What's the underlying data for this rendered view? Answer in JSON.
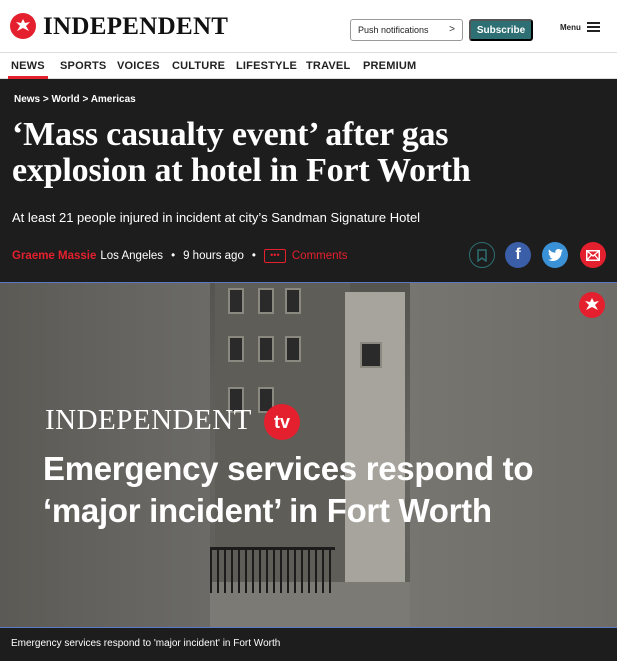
{
  "header": {
    "brand": "INDEPENDENT",
    "push_label": "Push notifications",
    "push_chevron": ">",
    "subscribe_label": "Subscribe",
    "menu_label": "Menu"
  },
  "nav": {
    "items": [
      "NEWS",
      "SPORTS",
      "VOICES",
      "CULTURE",
      "LIFESTYLE",
      "TRAVEL",
      "PREMIUM"
    ],
    "active": "NEWS"
  },
  "article": {
    "breadcrumb": "News > World > Americas",
    "headline": "‘Mass casualty event’ after gas explosion at hotel in Fort Worth",
    "standfirst": "At least 21 people injured in incident at city’s Sandman Signature Hotel",
    "author": "Graeme Massie",
    "location": "Los Angeles",
    "time": "9 hours ago",
    "comments_label": "Comments",
    "comments_icon": "•••"
  },
  "video": {
    "brand": "INDEPENDENT",
    "badge": "tv",
    "title": "Emergency services respond to ‘major incident’ in Fort Worth",
    "caption": "Emergency services respond to 'major incident' in Fort Worth"
  },
  "colors": {
    "accent_red": "#e5202e",
    "subscribe_teal": "#2d6f73",
    "dark_bg": "#1d1d1d",
    "facebook": "#3b5ea8",
    "twitter": "#3a91d6"
  },
  "icons": {
    "logo": "eagle-icon",
    "bookmark": "bookmark-icon",
    "facebook": "facebook-icon",
    "twitter": "twitter-icon",
    "email": "email-icon",
    "menu": "hamburger-icon"
  }
}
